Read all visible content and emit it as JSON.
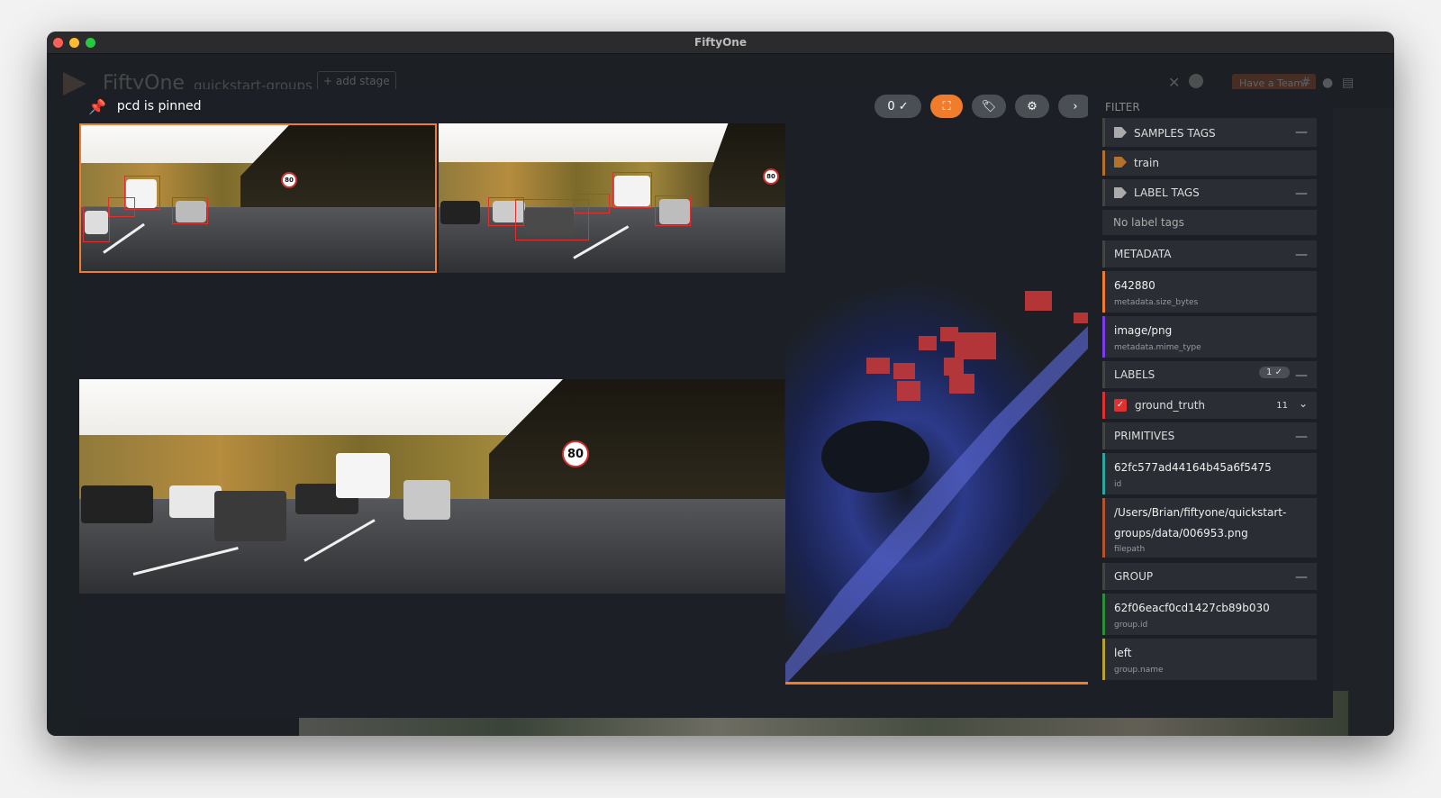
{
  "window": {
    "title": "FiftyOne"
  },
  "header": {
    "brand": "FiftyOne",
    "dataset": "quickstart-groups",
    "add_stage": "+ add stage",
    "team_button": "Have a Team?"
  },
  "modal": {
    "pinned_text": "pcd is pinned",
    "actions": {
      "selected_count": "0",
      "check_glyph": "✓"
    },
    "slices": [
      "left-thumbnail",
      "right-thumbnail",
      "main-image",
      "pcd"
    ]
  },
  "sidebar": {
    "filter_title": "FILTER",
    "sample_tags": {
      "title": "SAMPLES TAGS",
      "items": [
        "train"
      ]
    },
    "label_tags": {
      "title": "LABEL TAGS",
      "empty": "No label tags"
    },
    "metadata": {
      "title": "METADATA",
      "fields": [
        {
          "value": "642880",
          "key": "metadata.size_bytes",
          "color": "#f07c2c"
        },
        {
          "value": "image/png",
          "key": "metadata.mime_type",
          "color": "#7b3cf0"
        }
      ]
    },
    "labels": {
      "title": "LABELS",
      "badge": "1",
      "badge_glyph": "✓",
      "fields": [
        {
          "name": "ground_truth",
          "count": "11",
          "color": "#e03030"
        }
      ]
    },
    "primitives": {
      "title": "PRIMITIVES",
      "fields": [
        {
          "value": "62fc577ad44164b45a6f5475",
          "key": "id",
          "color": "#2aa8a0"
        },
        {
          "value1": "/Users/Brian/fiftyone/quickstart-",
          "value2": "groups/data/006953.png",
          "key": "filepath",
          "color": "#b5532a"
        }
      ]
    },
    "group": {
      "title": "GROUP",
      "fields": [
        {
          "value": "62f06eacf0cd1427cb89b030",
          "key": "group.id",
          "color": "#2e8f3a"
        },
        {
          "value": "left",
          "key": "group.name",
          "color": "#b8a32a"
        }
      ]
    }
  },
  "colors": {
    "accent": "#f07c2c",
    "bg": "#1c2026",
    "panel": "#2a2e34"
  }
}
